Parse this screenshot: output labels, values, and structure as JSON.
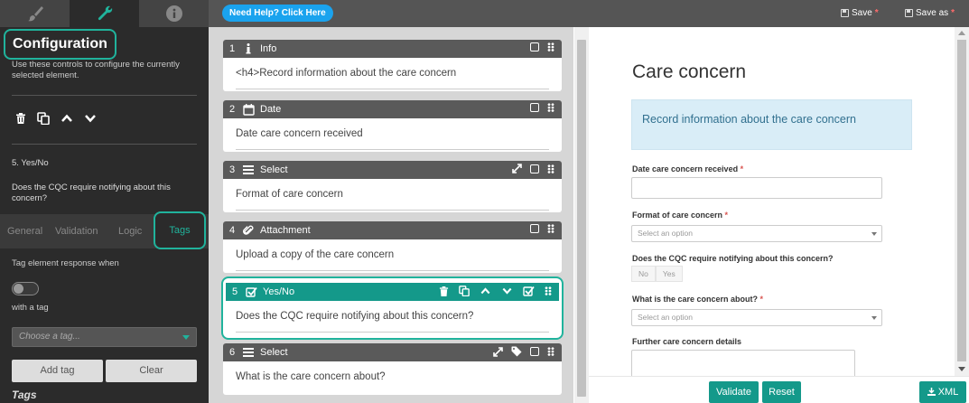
{
  "top": {
    "tabs": [
      {
        "icon": "paintbrush-icon",
        "active": false
      },
      {
        "icon": "wrench-icon",
        "active": true
      },
      {
        "icon": "info-icon",
        "active": false
      }
    ],
    "help_button": "Need Help? Click Here",
    "save_label": "Save",
    "save_as_label": "Save as",
    "unsaved_marker": "*"
  },
  "config": {
    "title": "Configuration",
    "description": "Use these controls to configure the currently selected element.",
    "element_name": "5. Yes/No",
    "element_question": "Does the CQC require notifying about this concern?",
    "tabs": [
      "General",
      "Validation",
      "Logic",
      "Tags"
    ],
    "active_tab": "Tags",
    "tag_when_label": "Tag element response when",
    "with_tag_label": "with a tag",
    "choose_tag_placeholder": "Choose a tag...",
    "add_tag_button": "Add tag",
    "clear_button": "Clear",
    "tags_heading": "Tags"
  },
  "elements": [
    {
      "num": "1",
      "icon": "info-icon",
      "type": "Info",
      "body": "<h4>Record information about the care concern"
    },
    {
      "num": "2",
      "icon": "calendar-icon",
      "type": "Date",
      "body": "Date care concern received"
    },
    {
      "num": "3",
      "icon": "list-icon",
      "type": "Select",
      "body": "Format of care concern"
    },
    {
      "num": "4",
      "icon": "paperclip-icon",
      "type": "Attachment",
      "body": "Upload a copy of the care concern"
    },
    {
      "num": "5",
      "icon": "checkbox-icon",
      "type": "Yes/No",
      "body": "Does the CQC require notifying about this concern?",
      "selected": true
    },
    {
      "num": "6",
      "icon": "list-icon",
      "type": "Select",
      "body": "What is the care concern about?"
    }
  ],
  "preview": {
    "title": "Care concern",
    "info_text": "Record information about the care concern",
    "fields": [
      {
        "label": "Date care concern received",
        "required": true
      },
      {
        "label": "Format of care concern",
        "required": true,
        "placeholder": "Select an option"
      },
      {
        "label": "Does the CQC require notifying about this concern?",
        "required": false,
        "options": [
          "No",
          "Yes"
        ]
      },
      {
        "label": "What is the care concern about?",
        "required": true,
        "placeholder": "Select an option"
      },
      {
        "label": "Further care concern details",
        "required": false
      }
    ],
    "required_marker": "*",
    "validate_button": "Validate",
    "reset_button": "Reset",
    "xml_button": "XML"
  },
  "colors": {
    "accent": "#20b39c",
    "teal_header": "#14998a",
    "help_blue": "#1aa3ee"
  }
}
